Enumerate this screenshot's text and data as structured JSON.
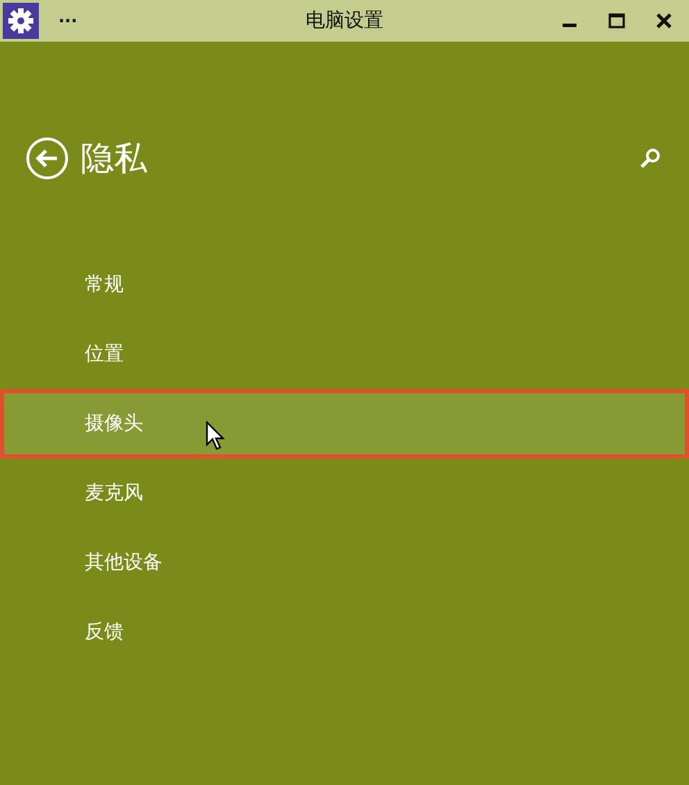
{
  "window": {
    "title": "电脑设置",
    "menu_glyph": "···"
  },
  "header": {
    "title": "隐私"
  },
  "items": [
    {
      "label": "常规",
      "selected": false
    },
    {
      "label": "位置",
      "selected": false
    },
    {
      "label": "摄像头",
      "selected": true
    },
    {
      "label": "麦克风",
      "selected": false
    },
    {
      "label": "其他设备",
      "selected": false
    },
    {
      "label": "反馈",
      "selected": false
    }
  ]
}
